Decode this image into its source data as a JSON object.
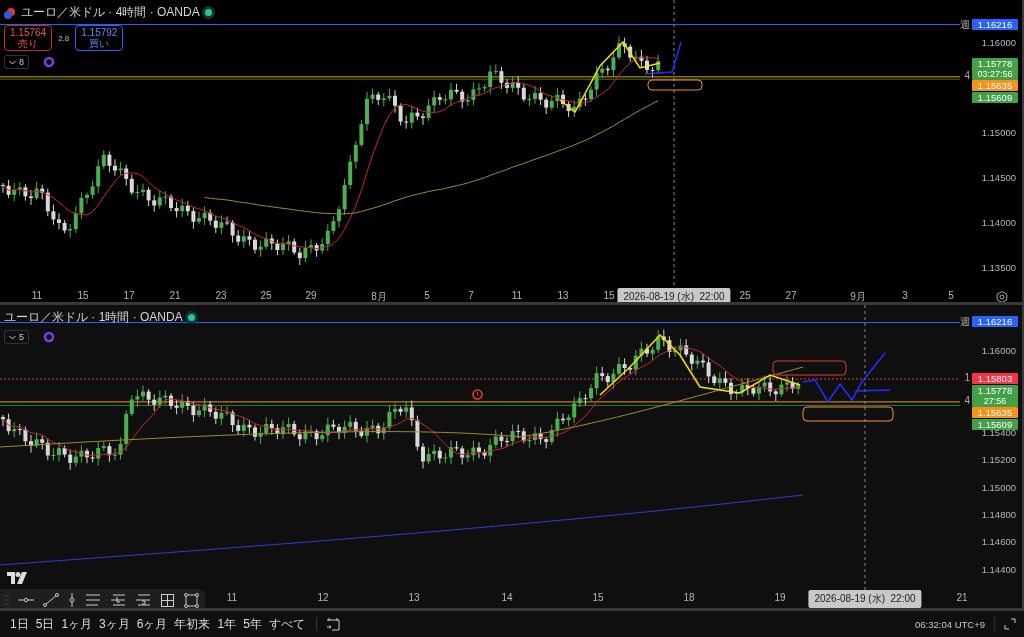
{
  "panes": [
    {
      "kind": "four_hour",
      "title": "ユーロ／米ドル · 4時間 · OANDA",
      "trade": {
        "sell_price": "1.15764",
        "sell_label": "売り",
        "spread": "2.8",
        "buy_price": "1.15792",
        "buy_label": "買い"
      },
      "indicator_count": "8",
      "price_ticks": [
        "1.16000",
        "1.15000",
        "1.14500",
        "1.14000",
        "1.13500"
      ],
      "price_tags": [
        {
          "text": "1.16216",
          "line_label": "週",
          "color": "#2962ff"
        },
        {
          "text": "1.15778",
          "subtext": "03:27:56",
          "color": "#43a047"
        },
        {
          "text": "1.15635",
          "line_label": "4",
          "color": "#f7931a"
        },
        {
          "text": "1.15609",
          "color": "#43a047"
        }
      ],
      "x_ticks": [
        "11",
        "15",
        "17",
        "21",
        "23",
        "25",
        "29",
        "8月",
        "5",
        "7",
        "11",
        "13",
        "15",
        "25",
        "27",
        "9月",
        "3",
        "5"
      ],
      "crosshair_time": "2026-08-19 (水)  22:00"
    },
    {
      "kind": "one_hour",
      "title": "ユーロ／米ドル · 1時間 · OANDA",
      "indicator_count": "5",
      "price_ticks": [
        "1.16000",
        "1.15400",
        "1.15200",
        "1.15000",
        "1.14800",
        "1.14600",
        "1.14400"
      ],
      "price_tags": [
        {
          "text": "1.16216",
          "line_label": "週",
          "color": "#2962ff"
        },
        {
          "text": "1.15803",
          "line_label": "1",
          "color": "#f23645"
        },
        {
          "text": "1.15778",
          "subtext": "27:56",
          "color": "#43a047"
        },
        {
          "text": "1.15635",
          "line_label": "4",
          "color": "#f7931a"
        },
        {
          "text": "1.15609",
          "color": "#43a047"
        }
      ],
      "x_ticks": [
        "11",
        "12",
        "13",
        "14",
        "15",
        "18",
        "19",
        "21"
      ],
      "crosshair_time": "2026-08-19 (水)  22:00"
    }
  ],
  "range_buttons": [
    "1日",
    "5日",
    "1ヶ月",
    "3ヶ月",
    "6ヶ月",
    "年初来",
    "1年",
    "5年",
    "すべて"
  ],
  "clock": "06:32:04 UTC+9"
}
